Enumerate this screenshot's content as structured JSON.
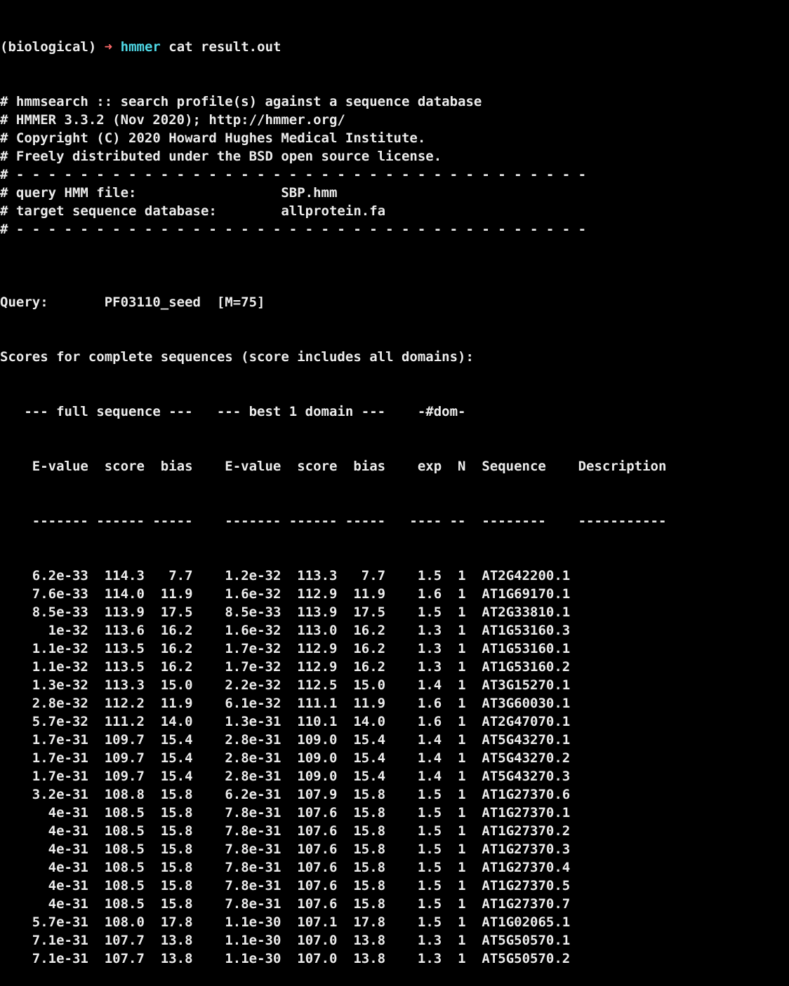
{
  "prompt": {
    "env": "(biological)",
    "arrow": "➜",
    "dir": "hmmer",
    "command": "cat result.out"
  },
  "header_lines": [
    "# hmmsearch :: search profile(s) against a sequence database",
    "# HMMER 3.3.2 (Nov 2020); http://hmmer.org/",
    "# Copyright (C) 2020 Howard Hughes Medical Institute.",
    "# Freely distributed under the BSD open source license.",
    "# - - - - - - - - - - - - - - - - - - - - - - - - - - - - - - - - - - - -",
    "# query HMM file:                  SBP.hmm",
    "# target sequence database:        allprotein.fa",
    "# - - - - - - - - - - - - - - - - - - - - - - - - - - - - - - - - - - - -",
    ""
  ],
  "query_line": "Query:       PF03110_seed  [M=75]",
  "scores_line": "Scores for complete sequences (score includes all domains):",
  "group_header": "   --- full sequence ---   --- best 1 domain ---    -#dom-",
  "column_header": "    E-value  score  bias    E-value  score  bias    exp  N  Sequence    Description",
  "column_rule": "    ------- ------ -----    ------- ------ -----   ---- --  --------    -----------",
  "rows": [
    {
      "e_full": "6.2e-33",
      "score_full": "114.3",
      "bias_full": "7.7",
      "e_dom": "1.2e-32",
      "score_dom": "113.3",
      "bias_dom": "7.7",
      "exp": "1.5",
      "n": "1",
      "sequence": "AT2G42200.1"
    },
    {
      "e_full": "7.6e-33",
      "score_full": "114.0",
      "bias_full": "11.9",
      "e_dom": "1.6e-32",
      "score_dom": "112.9",
      "bias_dom": "11.9",
      "exp": "1.6",
      "n": "1",
      "sequence": "AT1G69170.1"
    },
    {
      "e_full": "8.5e-33",
      "score_full": "113.9",
      "bias_full": "17.5",
      "e_dom": "8.5e-33",
      "score_dom": "113.9",
      "bias_dom": "17.5",
      "exp": "1.5",
      "n": "1",
      "sequence": "AT2G33810.1"
    },
    {
      "e_full": "1e-32",
      "score_full": "113.6",
      "bias_full": "16.2",
      "e_dom": "1.6e-32",
      "score_dom": "113.0",
      "bias_dom": "16.2",
      "exp": "1.3",
      "n": "1",
      "sequence": "AT1G53160.3"
    },
    {
      "e_full": "1.1e-32",
      "score_full": "113.5",
      "bias_full": "16.2",
      "e_dom": "1.7e-32",
      "score_dom": "112.9",
      "bias_dom": "16.2",
      "exp": "1.3",
      "n": "1",
      "sequence": "AT1G53160.1"
    },
    {
      "e_full": "1.1e-32",
      "score_full": "113.5",
      "bias_full": "16.2",
      "e_dom": "1.7e-32",
      "score_dom": "112.9",
      "bias_dom": "16.2",
      "exp": "1.3",
      "n": "1",
      "sequence": "AT1G53160.2"
    },
    {
      "e_full": "1.3e-32",
      "score_full": "113.3",
      "bias_full": "15.0",
      "e_dom": "2.2e-32",
      "score_dom": "112.5",
      "bias_dom": "15.0",
      "exp": "1.4",
      "n": "1",
      "sequence": "AT3G15270.1"
    },
    {
      "e_full": "2.8e-32",
      "score_full": "112.2",
      "bias_full": "11.9",
      "e_dom": "6.1e-32",
      "score_dom": "111.1",
      "bias_dom": "11.9",
      "exp": "1.6",
      "n": "1",
      "sequence": "AT3G60030.1"
    },
    {
      "e_full": "5.7e-32",
      "score_full": "111.2",
      "bias_full": "14.0",
      "e_dom": "1.3e-31",
      "score_dom": "110.1",
      "bias_dom": "14.0",
      "exp": "1.6",
      "n": "1",
      "sequence": "AT2G47070.1"
    },
    {
      "e_full": "1.7e-31",
      "score_full": "109.7",
      "bias_full": "15.4",
      "e_dom": "2.8e-31",
      "score_dom": "109.0",
      "bias_dom": "15.4",
      "exp": "1.4",
      "n": "1",
      "sequence": "AT5G43270.1"
    },
    {
      "e_full": "1.7e-31",
      "score_full": "109.7",
      "bias_full": "15.4",
      "e_dom": "2.8e-31",
      "score_dom": "109.0",
      "bias_dom": "15.4",
      "exp": "1.4",
      "n": "1",
      "sequence": "AT5G43270.2"
    },
    {
      "e_full": "1.7e-31",
      "score_full": "109.7",
      "bias_full": "15.4",
      "e_dom": "2.8e-31",
      "score_dom": "109.0",
      "bias_dom": "15.4",
      "exp": "1.4",
      "n": "1",
      "sequence": "AT5G43270.3"
    },
    {
      "e_full": "3.2e-31",
      "score_full": "108.8",
      "bias_full": "15.8",
      "e_dom": "6.2e-31",
      "score_dom": "107.9",
      "bias_dom": "15.8",
      "exp": "1.5",
      "n": "1",
      "sequence": "AT1G27370.6"
    },
    {
      "e_full": "4e-31",
      "score_full": "108.5",
      "bias_full": "15.8",
      "e_dom": "7.8e-31",
      "score_dom": "107.6",
      "bias_dom": "15.8",
      "exp": "1.5",
      "n": "1",
      "sequence": "AT1G27370.1"
    },
    {
      "e_full": "4e-31",
      "score_full": "108.5",
      "bias_full": "15.8",
      "e_dom": "7.8e-31",
      "score_dom": "107.6",
      "bias_dom": "15.8",
      "exp": "1.5",
      "n": "1",
      "sequence": "AT1G27370.2"
    },
    {
      "e_full": "4e-31",
      "score_full": "108.5",
      "bias_full": "15.8",
      "e_dom": "7.8e-31",
      "score_dom": "107.6",
      "bias_dom": "15.8",
      "exp": "1.5",
      "n": "1",
      "sequence": "AT1G27370.3"
    },
    {
      "e_full": "4e-31",
      "score_full": "108.5",
      "bias_full": "15.8",
      "e_dom": "7.8e-31",
      "score_dom": "107.6",
      "bias_dom": "15.8",
      "exp": "1.5",
      "n": "1",
      "sequence": "AT1G27370.4"
    },
    {
      "e_full": "4e-31",
      "score_full": "108.5",
      "bias_full": "15.8",
      "e_dom": "7.8e-31",
      "score_dom": "107.6",
      "bias_dom": "15.8",
      "exp": "1.5",
      "n": "1",
      "sequence": "AT1G27370.5"
    },
    {
      "e_full": "4e-31",
      "score_full": "108.5",
      "bias_full": "15.8",
      "e_dom": "7.8e-31",
      "score_dom": "107.6",
      "bias_dom": "15.8",
      "exp": "1.5",
      "n": "1",
      "sequence": "AT1G27370.7"
    },
    {
      "e_full": "5.7e-31",
      "score_full": "108.0",
      "bias_full": "17.8",
      "e_dom": "1.1e-30",
      "score_dom": "107.1",
      "bias_dom": "17.8",
      "exp": "1.5",
      "n": "1",
      "sequence": "AT1G02065.1"
    },
    {
      "e_full": "7.1e-31",
      "score_full": "107.7",
      "bias_full": "13.8",
      "e_dom": "1.1e-30",
      "score_dom": "107.0",
      "bias_dom": "13.8",
      "exp": "1.3",
      "n": "1",
      "sequence": "AT5G50570.1"
    },
    {
      "e_full": "7.1e-31",
      "score_full": "107.7",
      "bias_full": "13.8",
      "e_dom": "1.1e-30",
      "score_dom": "107.0",
      "bias_dom": "13.8",
      "exp": "1.3",
      "n": "1",
      "sequence": "AT5G50570.2"
    }
  ],
  "colors": {
    "background": "#000000",
    "text": "#ececec",
    "prompt_arrow": "#ff6a6a",
    "prompt_dir": "#4fd8e6"
  }
}
